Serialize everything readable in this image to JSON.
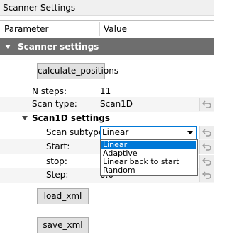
{
  "window": {
    "title": "Scanner Settings"
  },
  "columns": {
    "parameter": "Parameter",
    "value": "Value"
  },
  "group": {
    "label": "Scanner settings"
  },
  "buttons": {
    "calculate": "calculate_positions",
    "load": "load_xml",
    "save": "save_xml"
  },
  "params": {
    "n_steps": {
      "label": "N steps:",
      "value": "11"
    },
    "scan_type": {
      "label": "Scan type:",
      "value": "Scan1D"
    }
  },
  "scan1d": {
    "label": "Scan1D settings",
    "subtype": {
      "label": "Scan subtype:",
      "value": "Linear"
    },
    "start_label": "Start:",
    "stop_label": "stop:",
    "step_label": "Step:",
    "step_partial_value": "0.0"
  },
  "dropdown": {
    "options": [
      "Linear",
      "Adaptive",
      "Linear back to start",
      "Random"
    ],
    "selected_index": 0
  },
  "colors": {
    "accent": "#0078d7",
    "group_bg": "#6e6e6e"
  }
}
